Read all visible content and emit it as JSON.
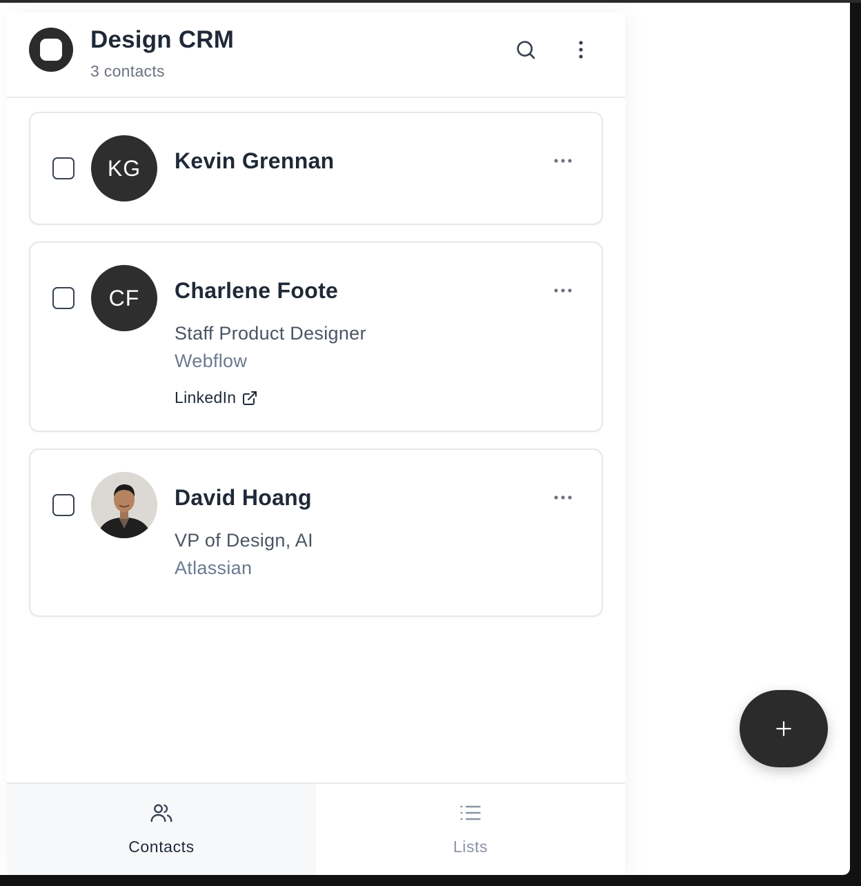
{
  "header": {
    "title": "Design CRM",
    "subtitle": "3 contacts"
  },
  "contacts": [
    {
      "initials": "KG",
      "name": "Kevin Grennan",
      "role": "",
      "company": "",
      "avatar": "initials"
    },
    {
      "initials": "CF",
      "name": "Charlene Foote",
      "role": "Staff Product Designer",
      "company": "Webflow",
      "link_label": "LinkedIn",
      "avatar": "initials"
    },
    {
      "initials": "",
      "name": "David Hoang",
      "role": "VP of Design, AI",
      "company": "Atlassian",
      "avatar": "photo"
    }
  ],
  "nav": {
    "contacts_label": "Contacts",
    "lists_label": "Lists",
    "active": "Contacts"
  },
  "icons": {
    "logo": "app-logo-icon",
    "search": "search-icon",
    "menu": "kebab-menu-icon",
    "card_menu": "more-horizontal-icon",
    "external": "external-link-icon",
    "contacts_tab": "users-icon",
    "lists_tab": "list-icon",
    "fab": "plus-icon"
  },
  "colors": {
    "primary_dark": "#2b2b2b",
    "text": "#1f2937",
    "muted": "#6b7280",
    "border": "#e5e7eb"
  }
}
